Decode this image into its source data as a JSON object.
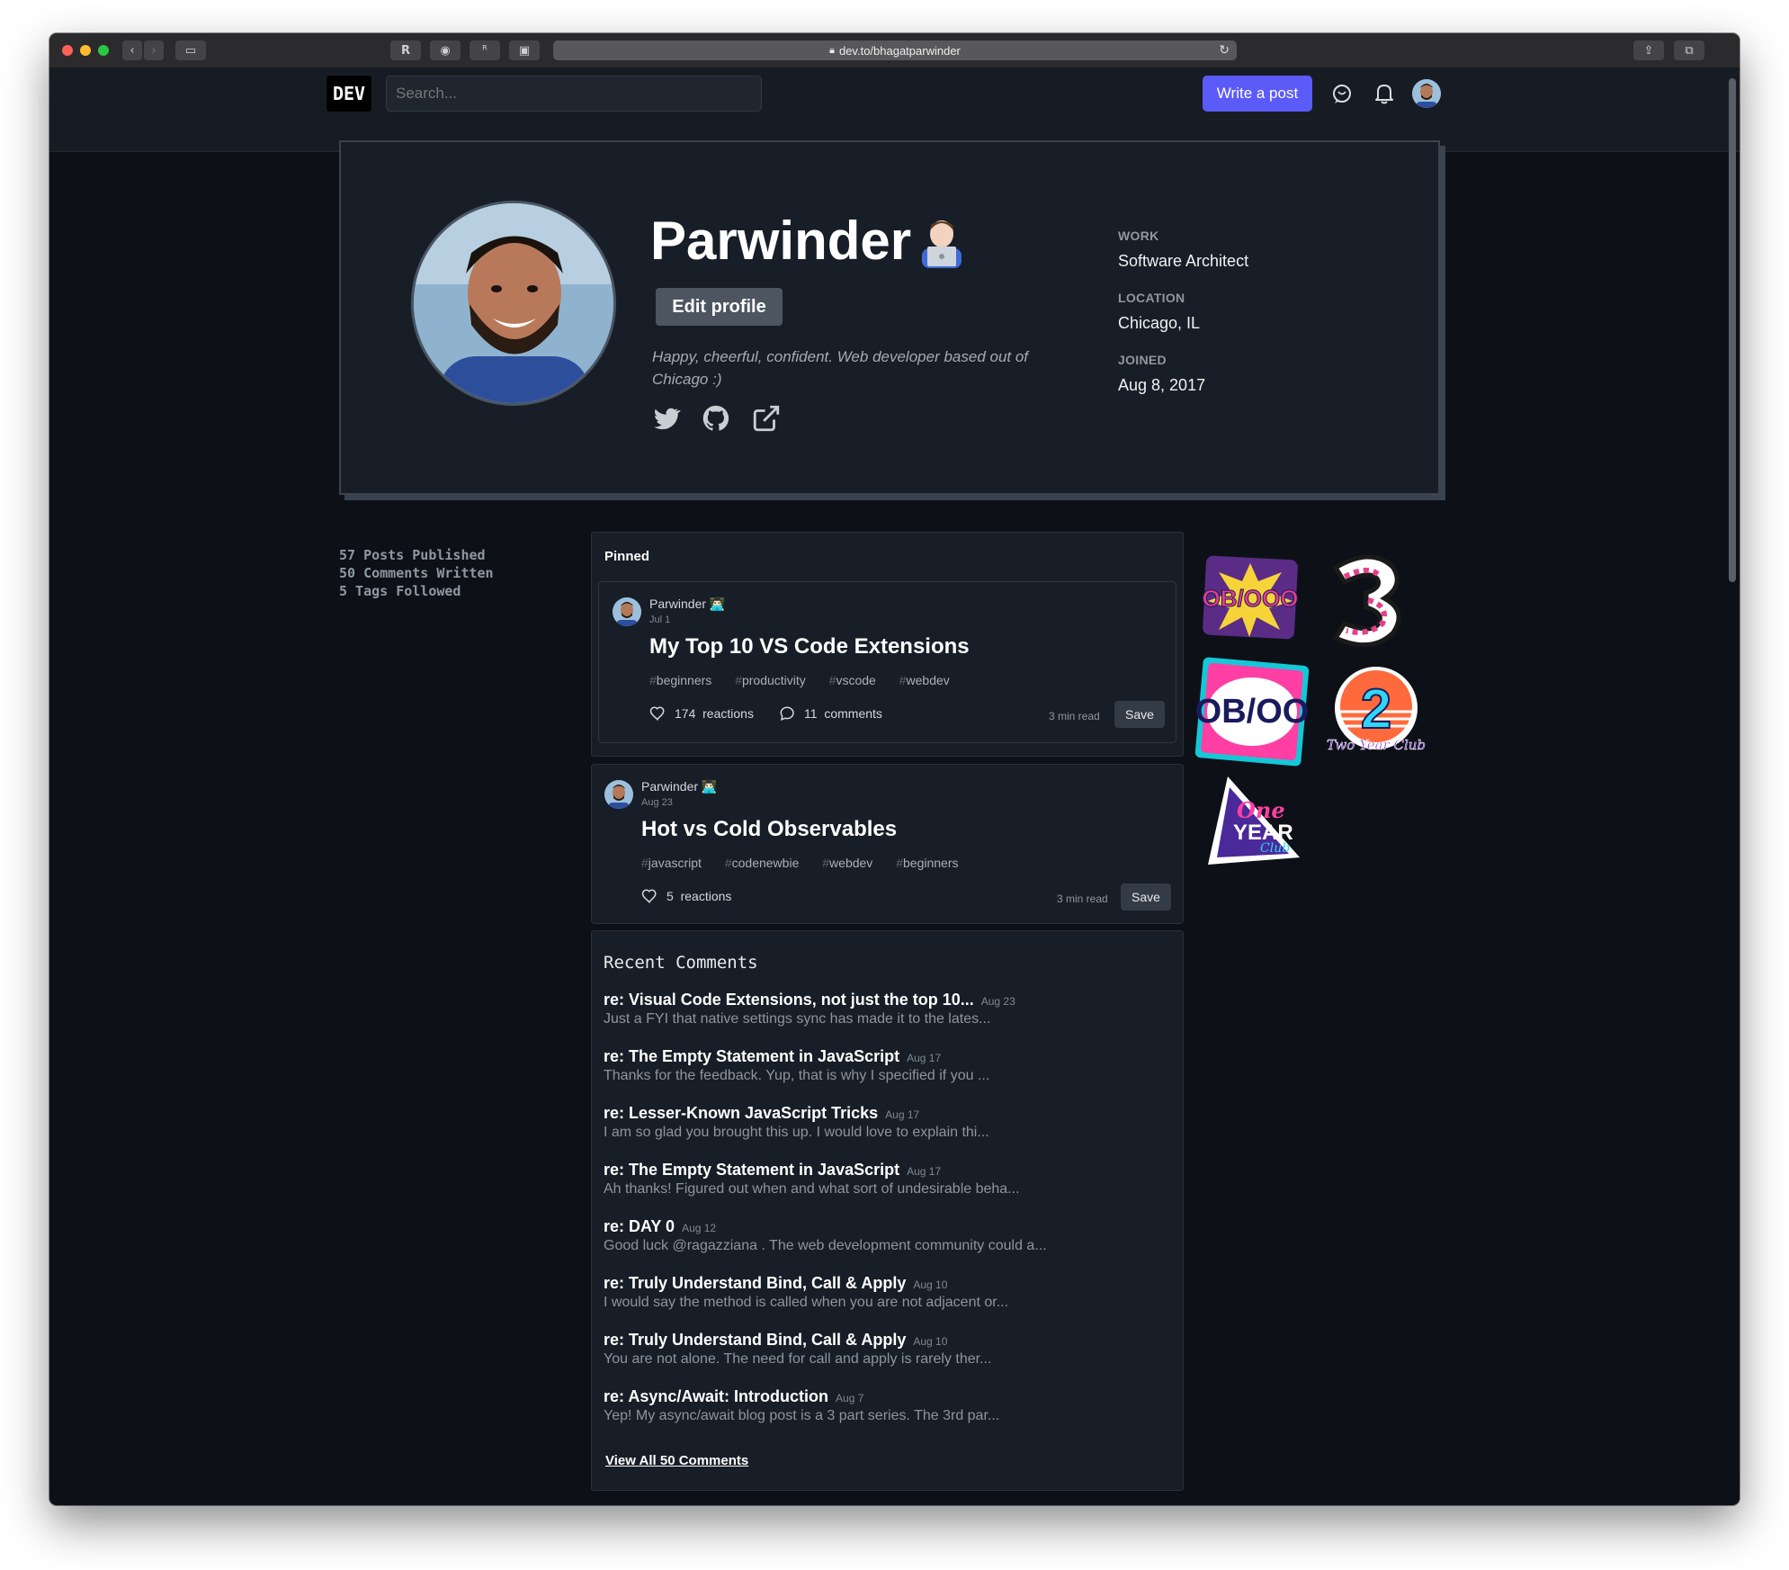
{
  "browser": {
    "url": "dev.to/bhagatparwinder"
  },
  "header": {
    "logo": "DEV",
    "search_placeholder": "Search...",
    "write_button": "Write a post"
  },
  "profile": {
    "name": "Parwinder",
    "edit_button": "Edit profile",
    "bio": "Happy, cheerful, confident. Web developer based out of Chicago :)",
    "work_label": "WORK",
    "work_value": "Software Architect",
    "location_label": "LOCATION",
    "location_value": "Chicago, IL",
    "joined_label": "JOINED",
    "joined_value": "Aug 8, 2017"
  },
  "stats": {
    "posts": "57 Posts Published",
    "comments": "50 Comments Written",
    "tags": "5 Tags Followed"
  },
  "pinned_label": "Pinned",
  "posts": [
    {
      "author": "Parwinder",
      "date": "Jul 1",
      "title": "My Top 10 VS Code Extensions",
      "tags": [
        "beginners",
        "productivity",
        "vscode",
        "webdev"
      ],
      "reactions_count": "174",
      "reactions_label": "reactions",
      "comments_count": "11",
      "comments_label": "comments",
      "read_time": "3 min read",
      "save": "Save"
    },
    {
      "author": "Parwinder",
      "date": "Aug 23",
      "title": "Hot vs Cold Observables",
      "tags": [
        "javascript",
        "codenewbie",
        "webdev",
        "beginners"
      ],
      "reactions_count": "5",
      "reactions_label": "reactions",
      "read_time": "3 min read",
      "save": "Save"
    }
  ],
  "recent_comments": {
    "heading": "Recent Comments",
    "items": [
      {
        "title": "re: Visual Code Extensions, not just the top 10...",
        "date": "Aug 23",
        "snippet": "Just a FYI that native settings sync has made it to the lates..."
      },
      {
        "title": "re: The Empty Statement in JavaScript",
        "date": "Aug 17",
        "snippet": "Thanks for the feedback. Yup, that is why I specified if you ..."
      },
      {
        "title": "re: Lesser-Known JavaScript Tricks",
        "date": "Aug 17",
        "snippet": "I am so glad you brought this up. I would love to explain thi..."
      },
      {
        "title": "re: The Empty Statement in JavaScript",
        "date": "Aug 17",
        "snippet": "Ah thanks! Figured out when and what sort of undesirable beha..."
      },
      {
        "title": "re: DAY 0",
        "date": "Aug 12",
        "snippet": "Good luck @ragazziana . The web development community could a..."
      },
      {
        "title": "re: Truly Understand Bind, Call & Apply",
        "date": "Aug 10",
        "snippet": "I would say the method is called when you are not adjacent or..."
      },
      {
        "title": "re: Truly Understand Bind, Call & Apply",
        "date": "Aug 10",
        "snippet": "You are not alone. The need for call and apply is rarely ther..."
      },
      {
        "title": "re: Async/Await: Introduction",
        "date": "Aug 7",
        "snippet": "Yep! My async/await blog post is a 3 part series. The 3rd par..."
      }
    ],
    "view_all": "View All 50 Comments"
  },
  "badges": {
    "b1": "OB/OOO",
    "b2": "3",
    "b3": "OB/OO",
    "b4": "2",
    "b4_sub": "Two Year Club",
    "b5_one": "One",
    "b5_year": "YEAR",
    "b5_club": "Club"
  },
  "colors": {
    "accent": "#5b5bf7",
    "background": "#0d1117",
    "card": "#171e27"
  }
}
